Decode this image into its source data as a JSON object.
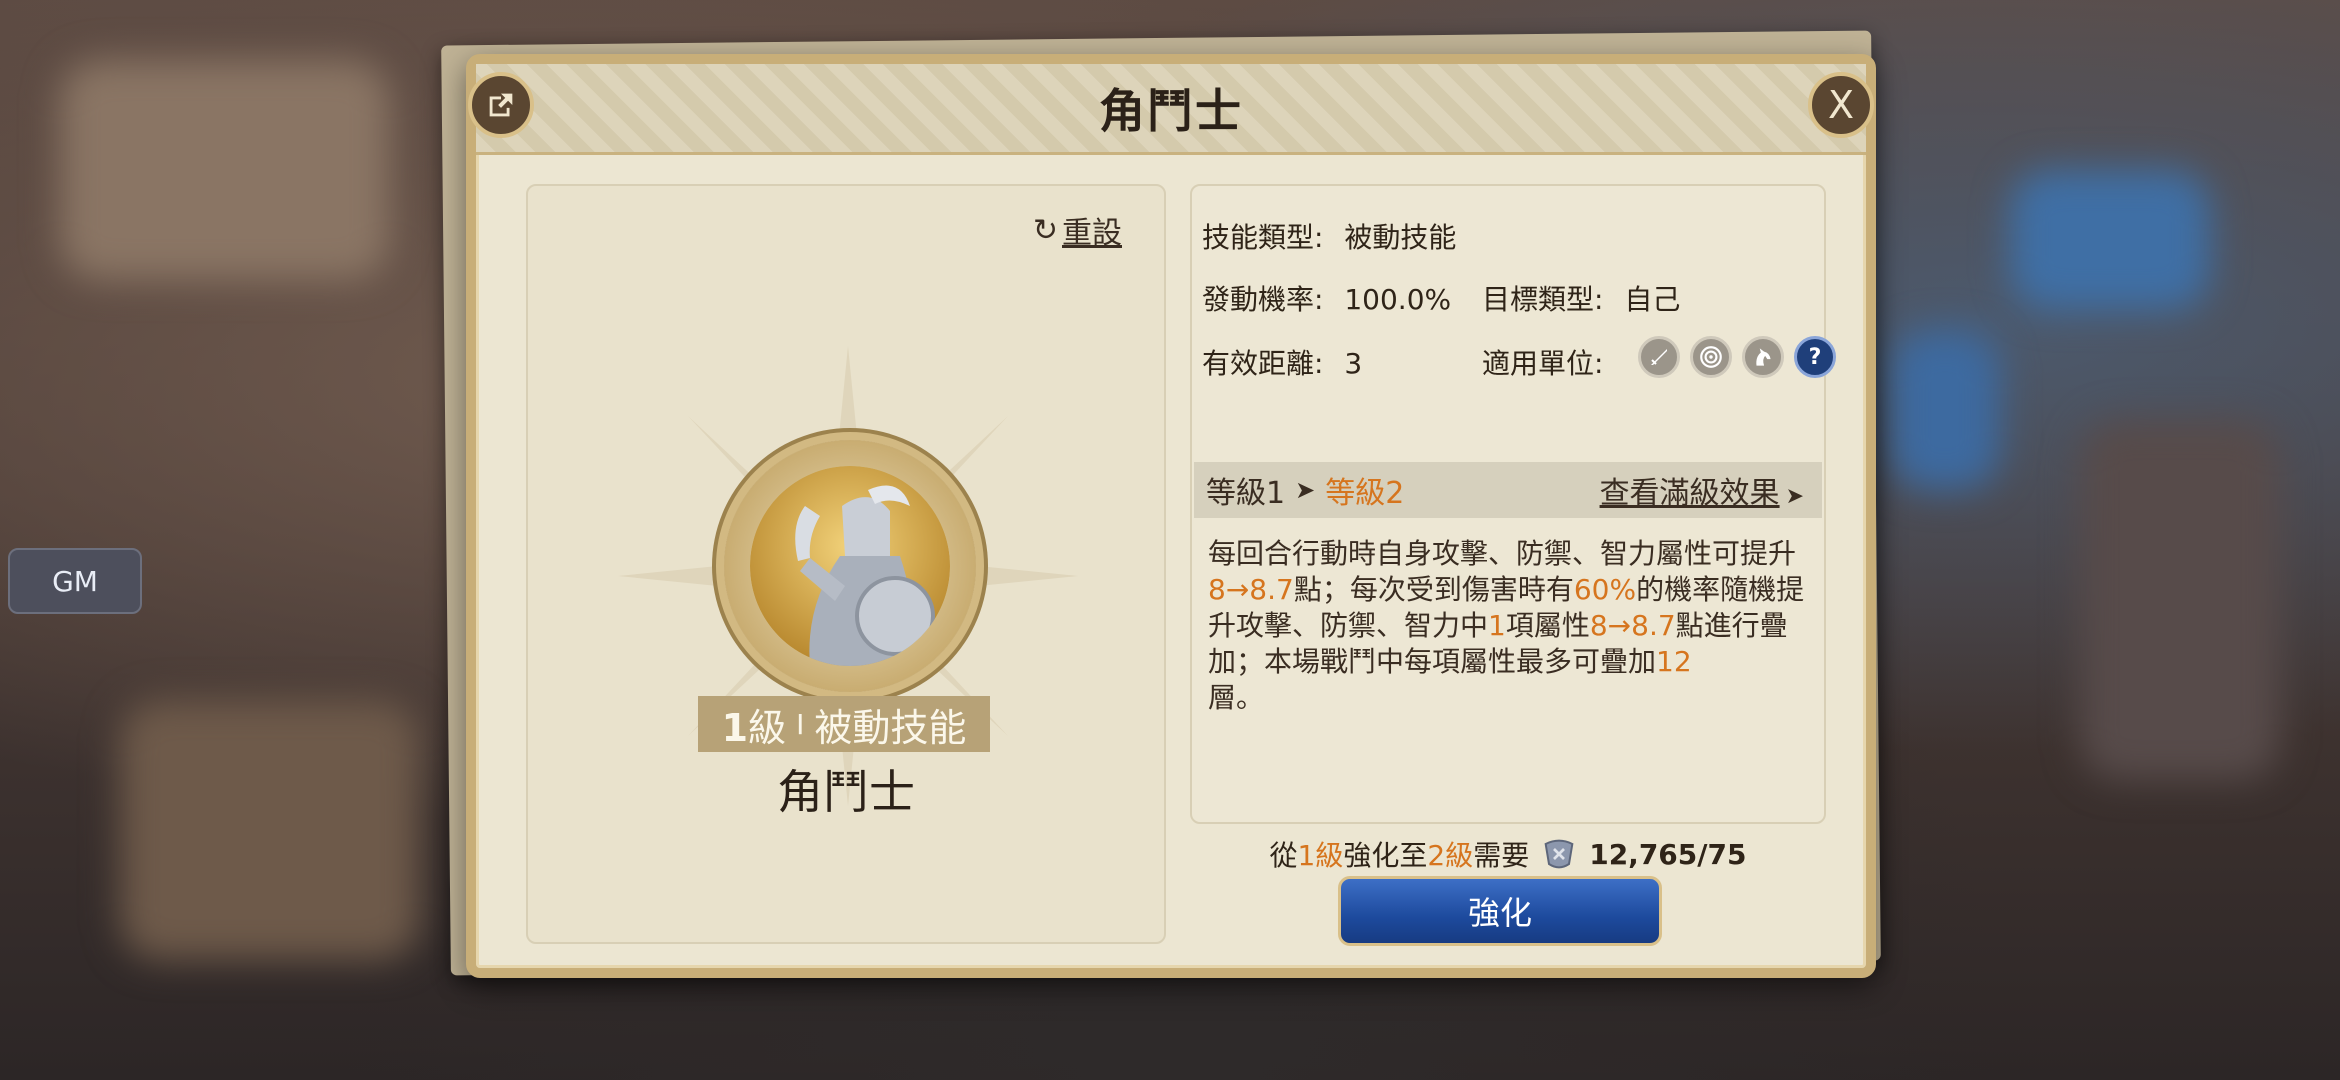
{
  "gm_label": "GM",
  "dialog": {
    "title": "角鬥士",
    "close_label": "X"
  },
  "left": {
    "reset_label": "重設",
    "level_num": "1",
    "level_unit": "級",
    "separator": "I",
    "skill_kind": "被動技能",
    "skill_name": "角鬥士"
  },
  "info": {
    "type_label": "技能類型:",
    "type_value": "被動技能",
    "rate_label": "發動機率:",
    "rate_value": "100.0%",
    "target_label": "目標類型:",
    "target_value": "自己",
    "range_label": "有效距離:",
    "range_value": "3",
    "units_label": "適用單位:",
    "unit_icons": [
      "sword-icon",
      "target-icon",
      "horse-icon",
      "question-icon"
    ],
    "q_glyph": "?"
  },
  "level": {
    "current": "等級1",
    "next": "等級2",
    "full_effect": "查看滿級效果"
  },
  "description": {
    "p1": "每回合行動時自身攻擊、防禦、智力屬性可提升",
    "v1": "8→8.7",
    "p2": "點；每次受到傷害時有",
    "v2": "60%",
    "p3": "的機率隨機提升攻擊、防禦、智力中",
    "v3": "1",
    "p4": "項屬性",
    "v4": "8→8.7",
    "p5": "點進行疊加；本場戰鬥中每項屬性最多可疊加",
    "v5": "12",
    "p6": "層。"
  },
  "cost": {
    "from": "從",
    "from_level": "1級",
    "mid": "強化至",
    "to_level": "2級",
    "need": "需要",
    "amount": "12,765/75"
  },
  "upgrade_label": "強化",
  "colors": {
    "accent": "#d6751e",
    "button": "#1d4a9d",
    "frame": "#c8ae78"
  }
}
